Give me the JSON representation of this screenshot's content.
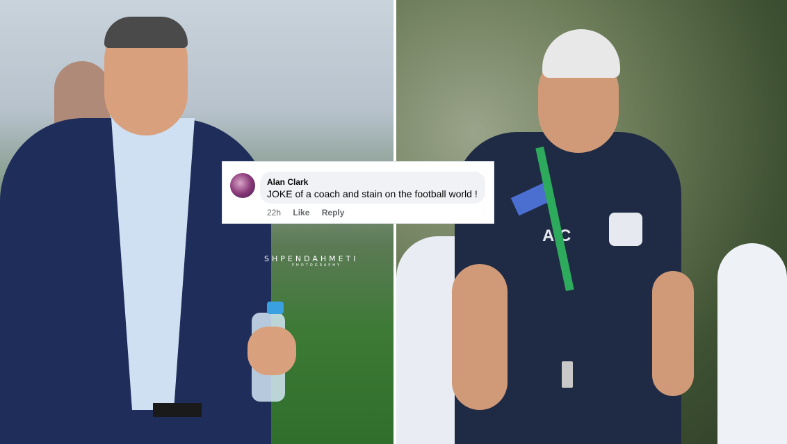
{
  "comment": {
    "faded_previous": "",
    "author": "Alan Clark",
    "text": "JOKE of a coach and stain on the football world !",
    "time": "22h",
    "like_label": "Like",
    "reply_label": "Reply"
  },
  "watermark": {
    "name": "SHPENDAHMETI",
    "sub": "PHOTOGRAPHY"
  },
  "right_photo": {
    "shirt_text": "A.C"
  },
  "colors": {
    "card_bg": "#ffffff",
    "bubble_bg": "#f0f2f5",
    "meta_text": "#65676b",
    "suit": "#1e2d5a",
    "polo": "#1f2a44",
    "lanyard": "#2eaa5c"
  }
}
